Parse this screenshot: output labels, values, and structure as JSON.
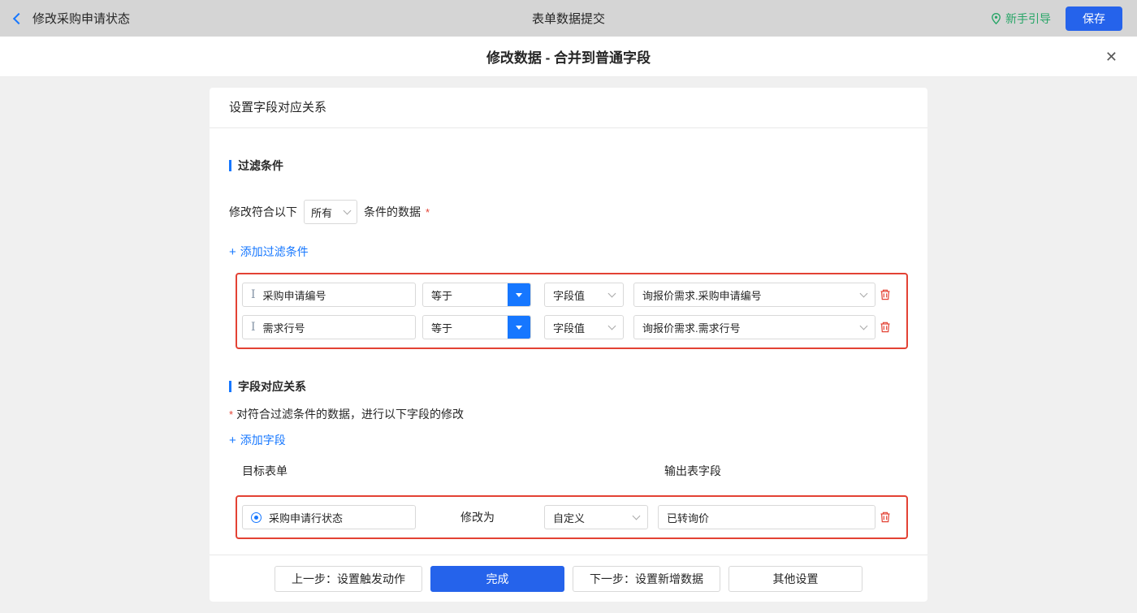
{
  "colors": {
    "accent": "#1677ff",
    "primary_button": "#2563eb",
    "danger": "#e34234",
    "guide_green": "#27a567",
    "topbar_bg": "#d5d5d5"
  },
  "icons": {
    "back": "chevron-left",
    "guide_pin": "location-pin",
    "plus": "+",
    "close": "✕",
    "text_field": "I",
    "radio": "circle-dot",
    "trash": "trash-outline",
    "caret": "chevron-down"
  },
  "topbar": {
    "back_label": "修改采购申请状态",
    "center_title": "表单数据提交",
    "guide_label": "新手引导",
    "save_label": "保存"
  },
  "dialog": {
    "title": "修改数据 - 合并到普通字段"
  },
  "card": {
    "header": "设置字段对应关系",
    "filter": {
      "section_title": "过滤条件",
      "prefix": "修改符合以下",
      "scope_value": "所有",
      "suffix": "条件的数据",
      "required": "*",
      "add_label": "添加过滤条件",
      "rows": [
        {
          "field": "采购申请编号",
          "operator": "等于",
          "value_type": "字段值",
          "value": "询报价需求.采购申请编号"
        },
        {
          "field": "需求行号",
          "operator": "等于",
          "value_type": "字段值",
          "value": "询报价需求.需求行号"
        }
      ]
    },
    "mapping": {
      "section_title": "字段对应关系",
      "required": "*",
      "description": "对符合过滤条件的数据，进行以下字段的修改",
      "add_label": "添加字段",
      "col_target": "目标表单",
      "col_output": "输出表字段",
      "rows": [
        {
          "field": "采购申请行状态",
          "action_label": "修改为",
          "value_type": "自定义",
          "value": "已转询价"
        }
      ]
    },
    "footer": {
      "prev": "上一步：设置触发动作",
      "done": "完成",
      "next": "下一步：设置新增数据",
      "other": "其他设置"
    }
  }
}
